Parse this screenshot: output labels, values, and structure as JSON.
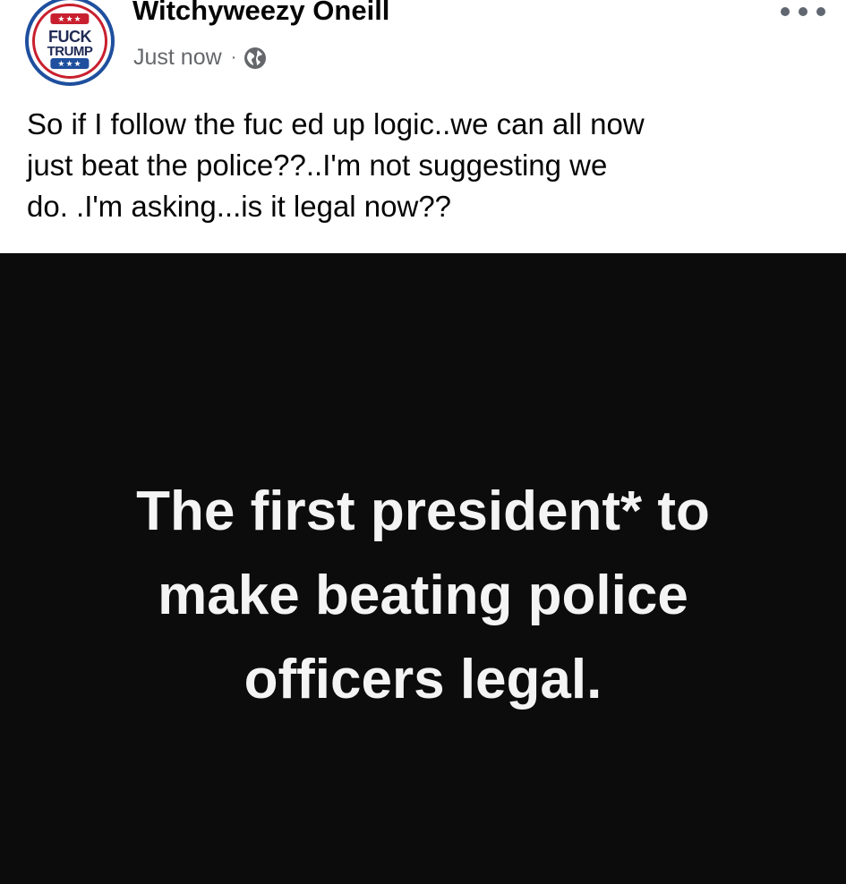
{
  "author": {
    "name": "Witchyweezy Oneill",
    "avatar": {
      "line1": "FUCK",
      "line2": "TRUMP",
      "stars": "★★★",
      "colors": {
        "red": "#c8202e",
        "blue": "#1f4f9e"
      }
    }
  },
  "meta": {
    "timestamp": "Just now",
    "separator": "·",
    "audience_icon": "globe-icon"
  },
  "menu": {
    "icon": "more-horizontal-icon"
  },
  "post": {
    "lines": [
      "So if I follow the fuc ed up logic..we can all now",
      "just beat the police??..I'm not suggesting we",
      "do. .I'm asking...is it legal now??"
    ]
  },
  "image": {
    "background": "#0c0c0c",
    "lines": [
      "The first president* to",
      "make beating police",
      "officers legal."
    ]
  }
}
